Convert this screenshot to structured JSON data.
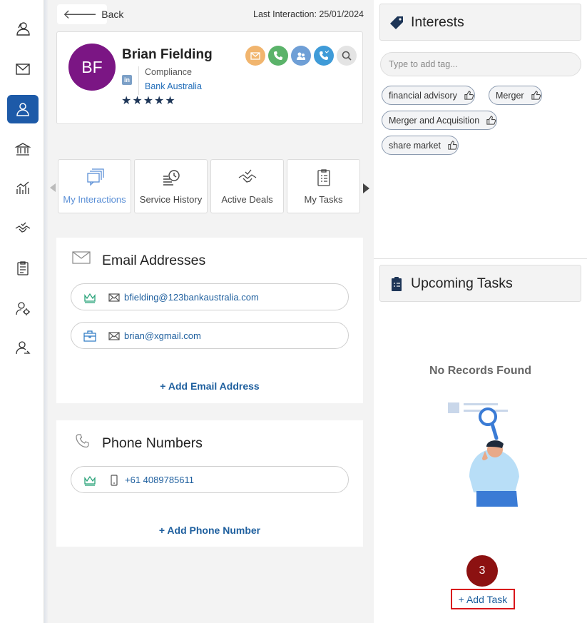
{
  "nav": {
    "items": [
      {
        "icon": "contacts-icon"
      },
      {
        "icon": "mail-icon"
      },
      {
        "icon": "person-icon",
        "active": true
      },
      {
        "icon": "bank-icon"
      },
      {
        "icon": "analytics-icon"
      },
      {
        "icon": "handshake-icon"
      },
      {
        "icon": "clipboard-icon"
      },
      {
        "icon": "user-settings-icon"
      },
      {
        "icon": "user-share-icon"
      }
    ]
  },
  "header": {
    "back_label": "Back",
    "last_interaction": "Last Interaction: 25/01/2024"
  },
  "profile": {
    "initials": "BF",
    "name": "Brian Fielding",
    "role": "Compliance",
    "company": "Bank Australia",
    "linkedin": "in",
    "rating": 5,
    "stars": "★★★★★",
    "actions": [
      "email-action-icon",
      "call-action-icon",
      "meeting-action-icon",
      "phone-log-action-icon",
      "search-action-icon"
    ]
  },
  "tabs": [
    {
      "label": "My Interactions",
      "active": true
    },
    {
      "label": "Service History"
    },
    {
      "label": "Active Deals"
    },
    {
      "label": "My Tasks"
    }
  ],
  "emails": {
    "title": "Email Addresses",
    "items": [
      {
        "value": "bfielding@123bankaustralia.com",
        "type": "primary"
      },
      {
        "value": "brian@xgmail.com",
        "type": "work"
      }
    ],
    "add_label": "+ Add Email Address"
  },
  "phones": {
    "title": "Phone Numbers",
    "items": [
      {
        "value": "+61 4089785611",
        "type": "primary"
      }
    ],
    "add_label": "+ Add Phone Number"
  },
  "interests": {
    "title": "Interests",
    "placeholder": "Type to add tag...",
    "tags": [
      "financial advisory",
      "Merger",
      "Merger and Acquisition",
      "share market"
    ]
  },
  "tasks": {
    "title": "Upcoming Tasks",
    "empty_text": "No Records Found",
    "step_badge": "3",
    "add_label": "+ Add Task"
  },
  "colors": {
    "accent": "#1d5aa8",
    "avatar": "#7b1684",
    "link": "#1e5f9e",
    "highlight_border": "#d9161b",
    "badge": "#8c1111"
  }
}
